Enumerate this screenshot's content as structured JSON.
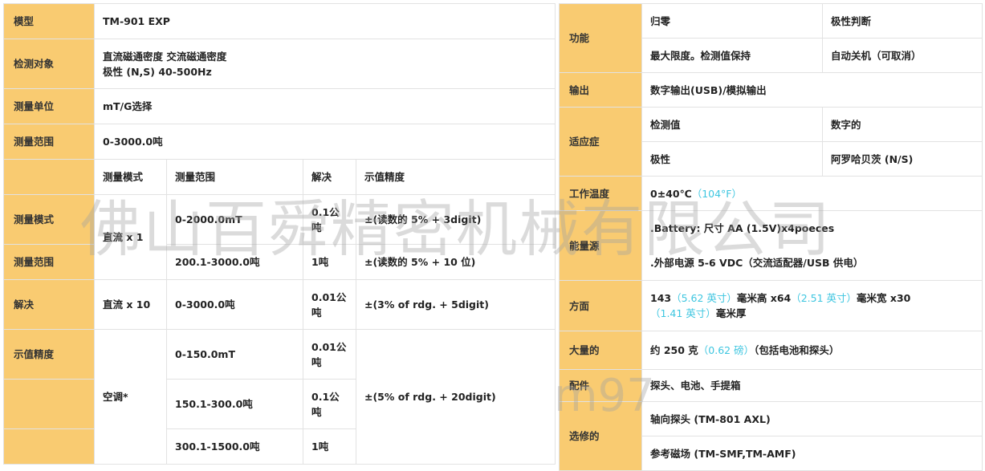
{
  "left": {
    "model_label": "模型",
    "model_value": "TM-901 EXP",
    "target_label": "检测对象",
    "target_line1": "直流磁通密度 交流磁通密度",
    "target_line2": "极性 (N,S) 40-500Hz",
    "unit_label": "测量单位",
    "unit_value": "mT/G选择",
    "range_label": "测量范围",
    "range_value": "0-3000.0吨",
    "sub_headers": [
      "测量模式",
      "测量范围",
      "解决",
      "示值精度"
    ],
    "side_labels": [
      "测量模式",
      "测量范围",
      "解决",
      "示值精度"
    ],
    "mode_dc1": "直流 x 1",
    "mode_dc10": "直流 x 10",
    "mode_ac": "空调*",
    "r1_range": "0-2000.0mT",
    "r1_res": "0.1公吨",
    "r1_acc": "±(读数的 5% + 3digit)",
    "r2_range": "200.1-3000.0吨",
    "r2_res": "1吨",
    "r2_acc": "±(读数的 5% + 10 位)",
    "r3_range": "0-3000.0吨",
    "r3_res": "0.01公吨",
    "r3_acc": "±(3% of rdg. + 5digit)",
    "r4_range": "0-150.0mT",
    "r4_res": "0.01公吨",
    "r5_range": "150.1-300.0吨",
    "r5_res": "0.1公吨",
    "ac_acc": "±(5% of rdg. + 20digit)",
    "r6_range": "300.1-1500.0吨",
    "r6_res": "1吨"
  },
  "right": {
    "func_label": "功能",
    "func_a1": "归零",
    "func_a2": "极性判断",
    "func_b1": "最大限度。检测值保持",
    "func_b2": "自动关机（可取消）",
    "output_label": "输出",
    "output_value": "数字输出(USB)/模拟输出",
    "ind_label": "适应症",
    "ind_a1": "检测值",
    "ind_a2": "数字的",
    "ind_b1": "极性",
    "ind_b2": "阿罗哈贝茨 (N/S)",
    "temp_label": "工作温度",
    "temp_value": "0±40℃",
    "temp_f": "（104°F）",
    "power_label": "能量源",
    "power_line1": ".Battery: 尺寸 AA (1.5V)x4poeces",
    "power_line2": ".外部电源 5-6 VDC（交流适配器/USB 供电）",
    "dim_label": "方面",
    "dim_p1": "143",
    "dim_p2": "（5.62 英寸）",
    "dim_p3": "毫米高 x64",
    "dim_p4": "（2.51 英寸）",
    "dim_p5": "毫米宽 x30",
    "dim_p6": "（1.41 英寸）",
    "dim_p7": "毫米厚",
    "weight_label": "大量的",
    "weight_p1": "约 250 克",
    "weight_p2": "（0.62 磅）",
    "weight_p3": "（包括电池和探头）",
    "acc_label": "配件",
    "acc_value": "探头、电池、手提箱",
    "opt_label": "选修的",
    "opt_value1": "轴向探头 (TM-801 AXL)",
    "opt_value2": "参考磁场 (TM-SMF,TM-AMF)"
  },
  "watermark": "佛山百舜精密机械有限公司",
  "watermark2": "m97"
}
